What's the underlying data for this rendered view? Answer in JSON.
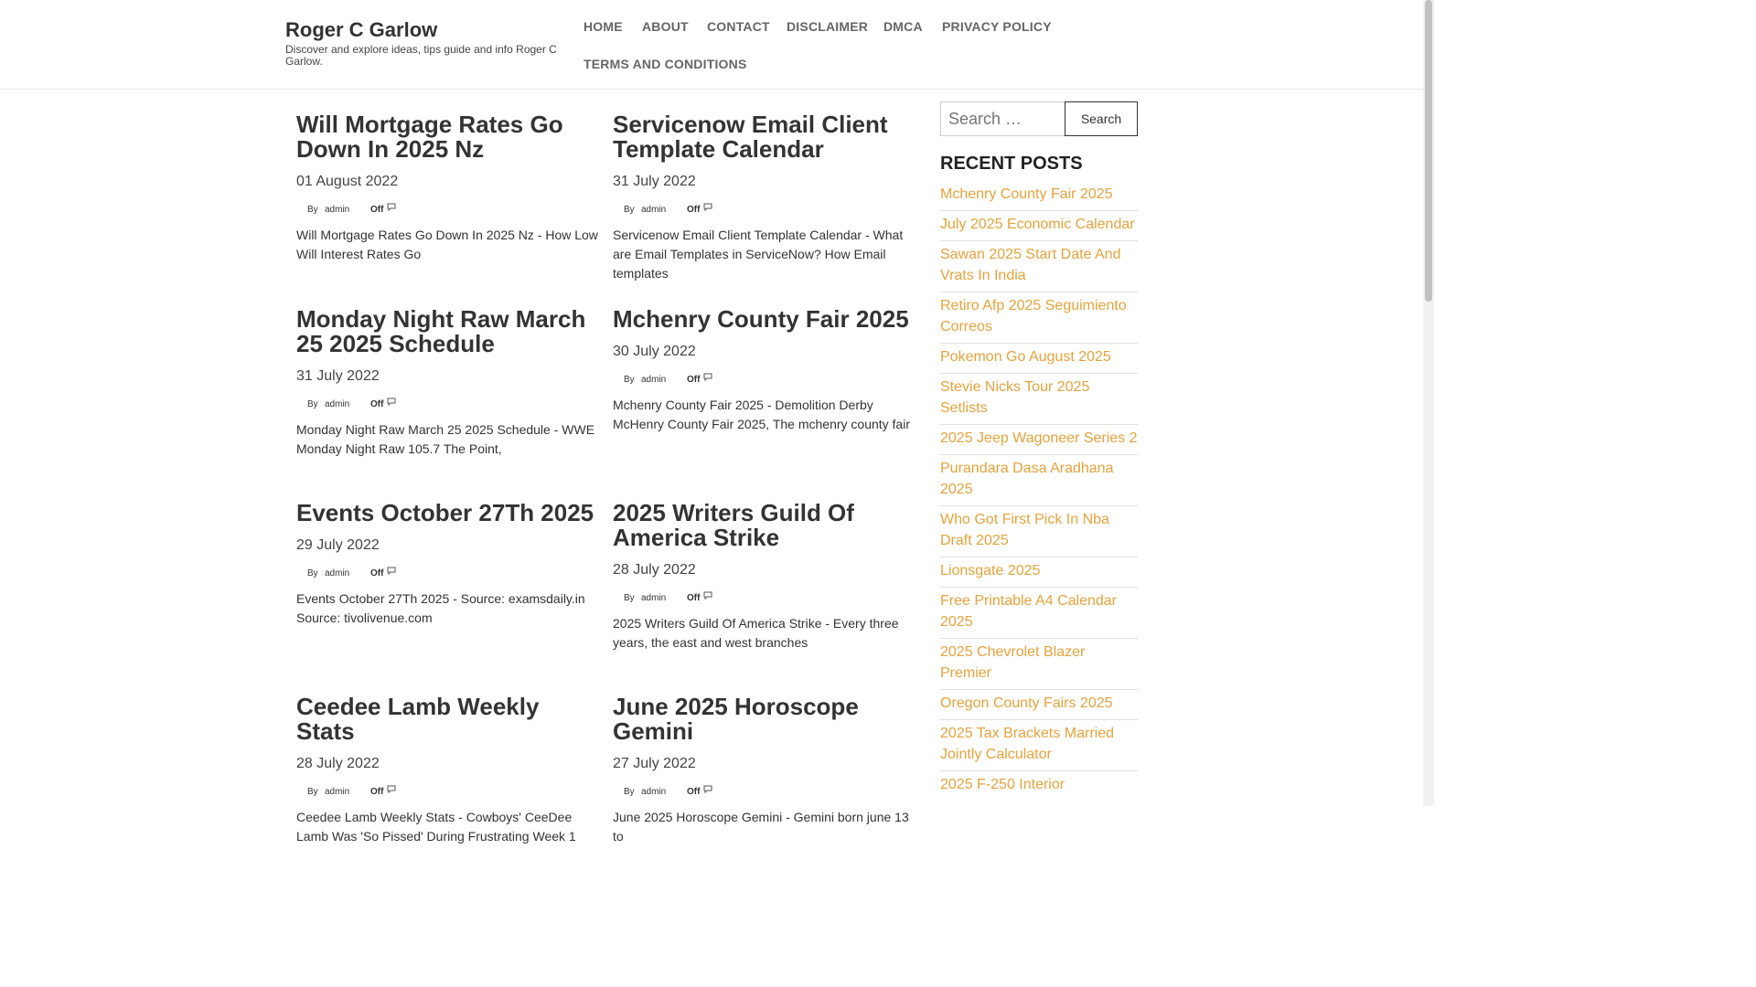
{
  "site": {
    "title": "Roger C Garlow",
    "description": "Discover and explore ideas, tips guide and info Roger C Garlow."
  },
  "nav": [
    "HOME",
    "ABOUT",
    "CONTACT",
    "DISCLAIMER",
    "DMCA",
    "PRIVACY POLICY",
    "TERMS AND CONDITIONS"
  ],
  "posts": [
    {
      "title": "Will Mortgage Rates Go Down In 2025 Nz",
      "date": "01 August 2022",
      "by": "By",
      "author": "admin",
      "comments": "Off",
      "excerpt": "Will Mortgage Rates Go Down In 2025 Nz - How Low Will Interest Rates Go"
    },
    {
      "title": "Servicenow Email Client Template Calendar",
      "date": "31 July 2022",
      "by": "By",
      "author": "admin",
      "comments": "Off",
      "excerpt": "Servicenow Email Client Template Calendar - What are Email Templates in ServiceNow? How Email templates"
    },
    {
      "title": "Monday Night Raw March 25 2025 Schedule",
      "date": "31 July 2022",
      "by": "By",
      "author": "admin",
      "comments": "Off",
      "excerpt": "Monday Night Raw March 25 2025 Schedule - WWE Monday Night Raw 105.7 The Point,"
    },
    {
      "title": "Mchenry County Fair 2025",
      "date": "30 July 2022",
      "by": "By",
      "author": "admin",
      "comments": "Off",
      "excerpt": "Mchenry County Fair 2025 - Demolition Derby McHenry County Fair 2025, The mchenry county fair"
    },
    {
      "title": "Events October 27Th 2025",
      "date": "29 July 2022",
      "by": "By",
      "author": "admin",
      "comments": "Off",
      "excerpt": "Events October 27Th 2025 - Source: examsdaily.in Source: tivolivenue.com"
    },
    {
      "title": "2025 Writers Guild Of America Strike",
      "date": "28 July 2022",
      "by": "By",
      "author": "admin",
      "comments": "Off",
      "excerpt": "2025 Writers Guild Of America Strike - Every three years, the east and west branches"
    },
    {
      "title": "Ceedee Lamb Weekly Stats",
      "date": "28 July 2022",
      "by": "By",
      "author": "admin",
      "comments": "Off",
      "excerpt": "Ceedee Lamb Weekly Stats - Cowboys' CeeDee Lamb Was 'So Pissed' During Frustrating Week 1"
    },
    {
      "title": "June 2025 Horoscope Gemini",
      "date": "27 July 2022",
      "by": "By",
      "author": "admin",
      "comments": "Off",
      "excerpt": "June 2025 Horoscope Gemini - Gemini born june 13 to"
    }
  ],
  "search": {
    "placeholder": "Search …",
    "button_label": "Search"
  },
  "recent_posts": {
    "heading": "RECENT POSTS",
    "items": [
      "Mchenry County Fair 2025",
      "July 2025 Economic Calendar",
      "Sawan 2025 Start Date And Vrats In India",
      "Retiro Afp 2025 Seguimiento Correos",
      "Pokemon Go August 2025",
      "Stevie Nicks Tour 2025 Setlists",
      "2025 Jeep Wagoneer Series 2",
      "Purandara Dasa Aradhana 2025",
      "Who Got First Pick In Nba Draft 2025",
      "Lionsgate 2025",
      "Free Printable A4 Calendar 2025",
      "2025 Chevrolet Blazer Premier",
      "Oregon County Fairs 2025",
      "2025 Tax Brackets Married Jointly Calculator",
      "2025 F-250 Interior"
    ]
  },
  "colors": {
    "link_accent": "#e8a23a",
    "heading": "#333333",
    "nav": "#666666"
  }
}
